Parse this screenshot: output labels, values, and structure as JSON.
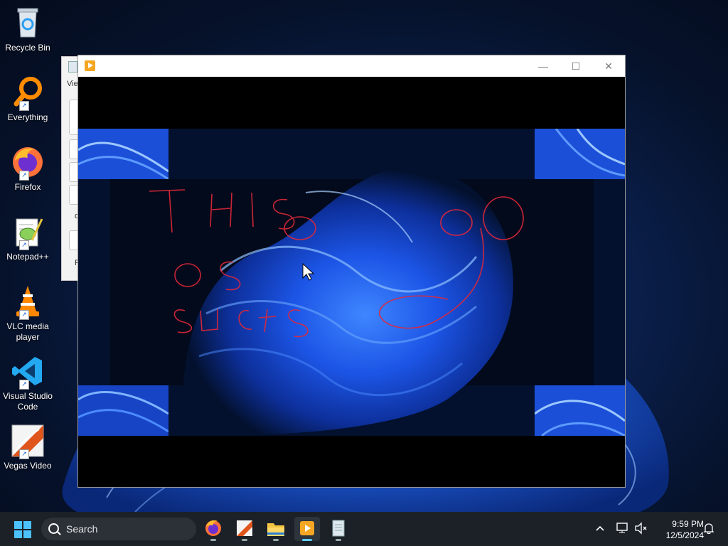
{
  "desktop": {
    "icons": [
      {
        "label": "Recycle Bin",
        "icon": "recycle-bin-icon"
      },
      {
        "label": "Everything",
        "icon": "everything-search-icon"
      },
      {
        "label": "Firefox",
        "icon": "firefox-icon"
      },
      {
        "label": "Notepad++",
        "icon": "notepad-plus-plus-icon"
      },
      {
        "label": "VLC media player",
        "icon": "vlc-icon"
      },
      {
        "label": "Visual Studio Code",
        "icon": "vscode-icon"
      },
      {
        "label": "Vegas Video",
        "icon": "vegas-video-icon"
      }
    ]
  },
  "background_window": {
    "menu_label": "Vie",
    "row_labels": [
      "d",
      "F"
    ]
  },
  "video_window": {
    "title": "",
    "controls": {
      "minimize": "—",
      "maximize": "☐",
      "close": "✕"
    }
  },
  "taskbar": {
    "search_placeholder": "Search",
    "apps": [
      "firefox-icon",
      "vegas-video-icon",
      "file-explorer-icon",
      "video-player-icon",
      "notepad-icon"
    ],
    "active_app": "video-player-icon"
  },
  "tray": {
    "time": "9:59 PM",
    "date": "12/5/2024"
  },
  "colors": {
    "accent": "#4cc2ff",
    "taskbar": "#1c2128",
    "drawing": "#e0283a"
  }
}
